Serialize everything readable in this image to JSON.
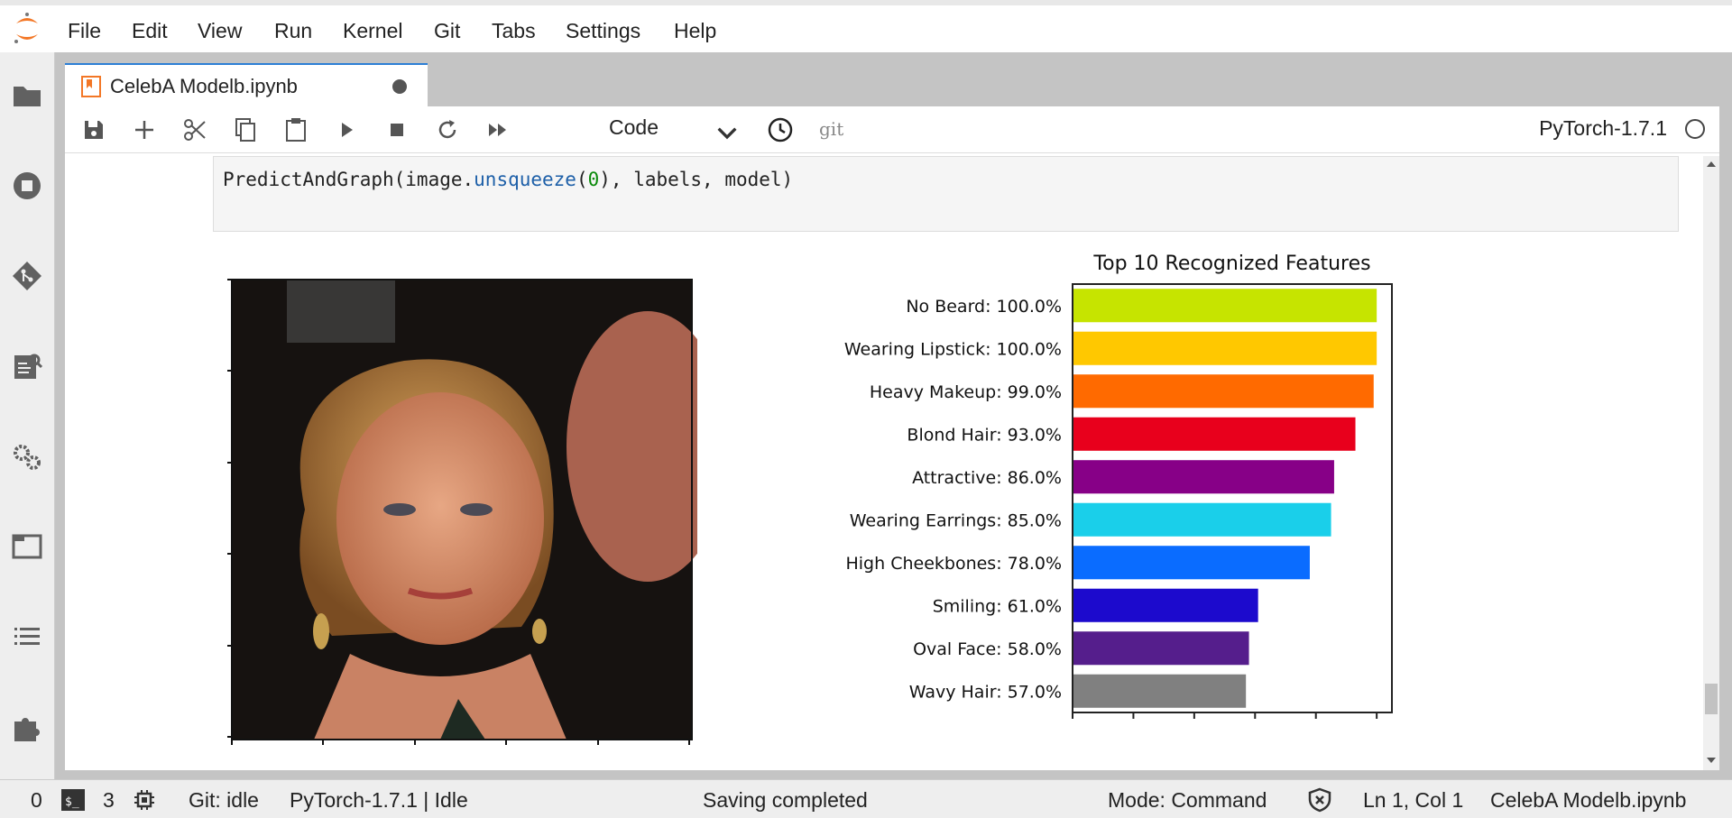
{
  "menu": [
    "File",
    "Edit",
    "View",
    "Run",
    "Kernel",
    "Git",
    "Tabs",
    "Settings",
    "Help"
  ],
  "tab": {
    "title": "CelebA Modelb.ipynb"
  },
  "toolbar": {
    "cell_type": "Code",
    "git_label": "git",
    "kernel": "PyTorch-1.7.1"
  },
  "code": {
    "fn": "PredictAndGraph(image.",
    "method": "unsqueeze",
    "open": "(",
    "num": "0",
    "rest": "), labels, model)"
  },
  "sidebar_icons": [
    "folder-icon",
    "stop-circle-icon",
    "git-icon",
    "property-inspector-icon",
    "gears-icon",
    "tabs-icon",
    "toc-icon",
    "extension-icon"
  ],
  "statusbar": {
    "terminals": "0",
    "kernels": "3",
    "git": "Git: idle",
    "kernel_status": "PyTorch-1.7.1 | Idle",
    "message": "Saving completed",
    "mode": "Mode: Command",
    "position": "Ln 1, Col 1",
    "file": "CelebA Modelb.ipynb"
  },
  "colors": {
    "accent": "#f37726",
    "tab_border": "#2d7fd5"
  },
  "chart_data": {
    "type": "bar",
    "orientation": "horizontal",
    "title": "Top 10 Recognized Features",
    "categories": [
      "No Beard: 100.0%",
      "Wearing Lipstick: 100.0%",
      "Heavy Makeup: 99.0%",
      "Blond Hair: 93.0%",
      "Attractive: 86.0%",
      "Wearing Earrings: 85.0%",
      "High Cheekbones: 78.0%",
      "Smiling: 61.0%",
      "Oval Face: 58.0%",
      "Wavy Hair: 57.0%"
    ],
    "values": [
      100.0,
      100.0,
      99.0,
      93.0,
      86.0,
      85.0,
      78.0,
      61.0,
      58.0,
      57.0
    ],
    "colors": [
      "#c6e400",
      "#ffc800",
      "#ff6a00",
      "#e8001c",
      "#870087",
      "#1acfea",
      "#0a6cff",
      "#1c0acd",
      "#551e8c",
      "#808080"
    ],
    "xlim": [
      0,
      105
    ],
    "grid": false
  }
}
